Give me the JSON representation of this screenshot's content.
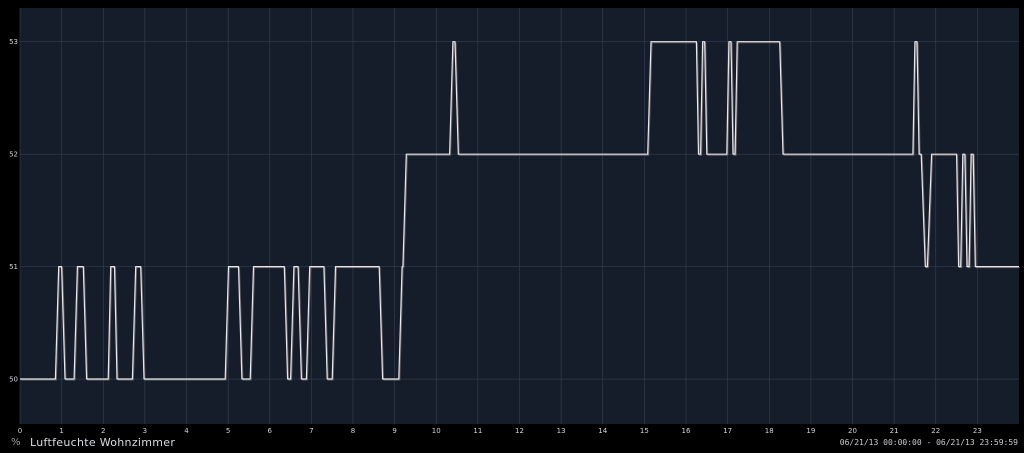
{
  "chart_data": {
    "type": "line",
    "unit": "%",
    "series_name": "Luftfeuchte Wohnzimmer",
    "time_range": "06/21/13 00:00:00 - 06/21/13 23:59:59",
    "xlim": [
      0,
      24
    ],
    "ylim": [
      49.6,
      53.3
    ],
    "x_ticks": [
      "0",
      "1",
      "2",
      "3",
      "4",
      "5",
      "6",
      "7",
      "8",
      "9",
      "10",
      "11",
      "12",
      "13",
      "14",
      "15",
      "16",
      "17",
      "18",
      "19",
      "20",
      "21",
      "22",
      "23"
    ],
    "y_ticks": [
      "50",
      "51",
      "52",
      "53"
    ],
    "grid": true,
    "colors": {
      "background": "#161d2a",
      "grid": "#344052",
      "line": "#e6e8ec",
      "line_shadow": "#8a7a78",
      "frame": "#000000"
    },
    "series": [
      {
        "x": [
          0,
          0.85,
          0.93,
          1.0,
          1.08,
          1.3,
          1.38,
          1.52,
          1.6,
          2.12,
          2.18,
          2.27,
          2.33,
          2.7,
          2.78,
          2.9,
          2.98,
          4.93,
          5.01,
          5.25,
          5.33,
          5.53,
          5.61,
          6.35,
          6.43,
          6.5,
          6.58,
          6.68,
          6.76,
          6.88,
          6.96,
          7.3,
          7.38,
          7.5,
          7.58,
          8.63,
          8.71,
          9.1,
          9.18,
          9.2,
          9.28,
          10.32,
          10.4,
          10.45,
          10.53,
          15.08,
          15.16,
          16.25,
          16.3,
          16.35,
          16.4,
          16.45,
          16.5,
          16.98,
          17.03,
          17.08,
          17.13,
          17.18,
          17.23,
          18.25,
          18.33,
          21.45,
          21.5,
          21.55,
          21.6,
          21.65,
          21.75,
          21.8,
          21.9,
          22.5,
          22.55,
          22.6,
          22.65,
          22.7,
          22.75,
          22.8,
          22.85,
          22.9,
          22.95,
          24
        ],
        "y": [
          50,
          50,
          51,
          51,
          50,
          50,
          51,
          51,
          50,
          50,
          51,
          51,
          50,
          50,
          51,
          51,
          50,
          50,
          51,
          51,
          50,
          50,
          51,
          51,
          50,
          50,
          51,
          51,
          50,
          50,
          51,
          51,
          50,
          50,
          51,
          51,
          50,
          50,
          51,
          51,
          52,
          52,
          53,
          53,
          52,
          52,
          53,
          53,
          52,
          52,
          53,
          53,
          52,
          52,
          53,
          53,
          52,
          52,
          53,
          53,
          52,
          52,
          53,
          53,
          52,
          52,
          51,
          51,
          52,
          52,
          51,
          51,
          52,
          52,
          51,
          51,
          52,
          52,
          51,
          51
        ]
      }
    ]
  }
}
